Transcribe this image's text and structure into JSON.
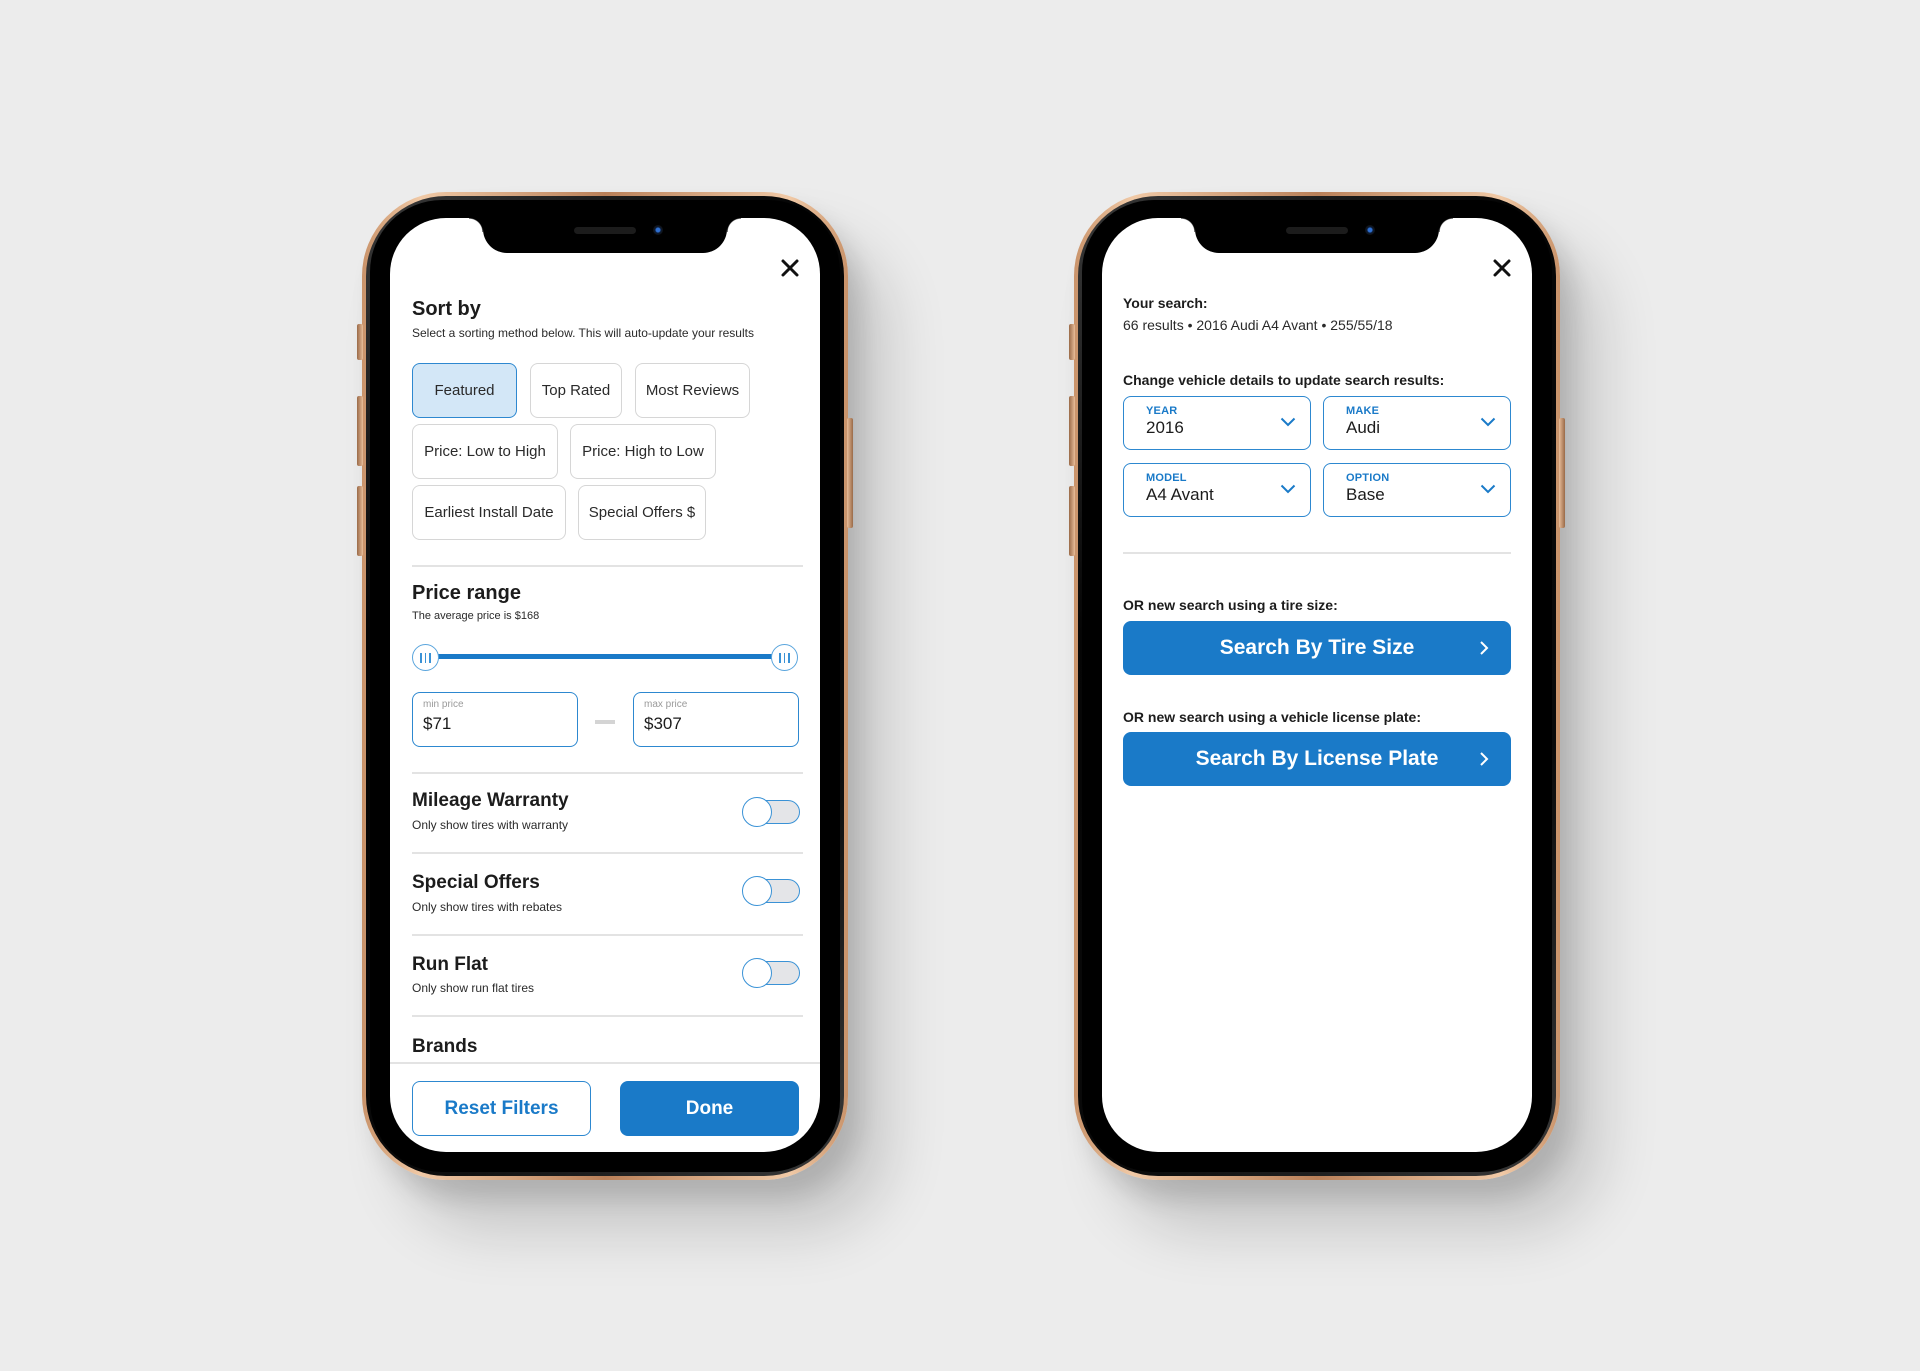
{
  "filters_screen": {
    "close_icon": "close-icon",
    "sort": {
      "title": "Sort by",
      "subtitle": "Select a sorting method below. This will auto-update your results",
      "options": [
        {
          "label": "Featured",
          "selected": true
        },
        {
          "label": "Top Rated",
          "selected": false
        },
        {
          "label": "Most Reviews",
          "selected": false
        },
        {
          "label": "Price: Low to High",
          "selected": false
        },
        {
          "label": "Price: High to Low",
          "selected": false
        },
        {
          "label": "Earliest Install Date",
          "selected": false
        },
        {
          "label": "Special Offers $",
          "selected": false
        }
      ]
    },
    "price_range": {
      "title": "Price range",
      "subtitle": "The average price is $168",
      "slider_min_fraction": 0.0,
      "slider_max_fraction": 1.0,
      "min_label": "min price",
      "min_value": "$71",
      "max_label": "max price",
      "max_value": "$307"
    },
    "toggles": [
      {
        "title": "Mileage Warranty",
        "subtitle": "Only show tires with warranty",
        "on": false
      },
      {
        "title": "Special Offers",
        "subtitle": "Only show tires with rebates",
        "on": false
      },
      {
        "title": "Run Flat",
        "subtitle": "Only show run flat tires",
        "on": false
      }
    ],
    "brands_title": "Brands",
    "footer": {
      "reset_label": "Reset Filters",
      "done_label": "Done"
    }
  },
  "vehicle_screen": {
    "close_icon": "close-icon",
    "your_search_label": "Your search:",
    "search_summary": "66 results • 2016 Audi A4 Avant • 255/55/18",
    "change_prompt": "Change vehicle details to update search results:",
    "dropdowns": [
      {
        "label": "YEAR",
        "value": "2016"
      },
      {
        "label": "MAKE",
        "value": "Audi"
      },
      {
        "label": "MODEL",
        "value": "A4 Avant"
      },
      {
        "label": "OPTION",
        "value": "Base"
      }
    ],
    "tire_size_prompt": "OR new search using a tire size:",
    "tire_size_button": "Search By Tire Size",
    "license_prompt": "OR new search using a vehicle license plate:",
    "license_button": "Search By License Plate"
  },
  "colors": {
    "accent": "#1a7ac8",
    "accent_border": "#2d88d0",
    "chip_selected_bg": "#d3e7f7",
    "background": "#ececec"
  }
}
